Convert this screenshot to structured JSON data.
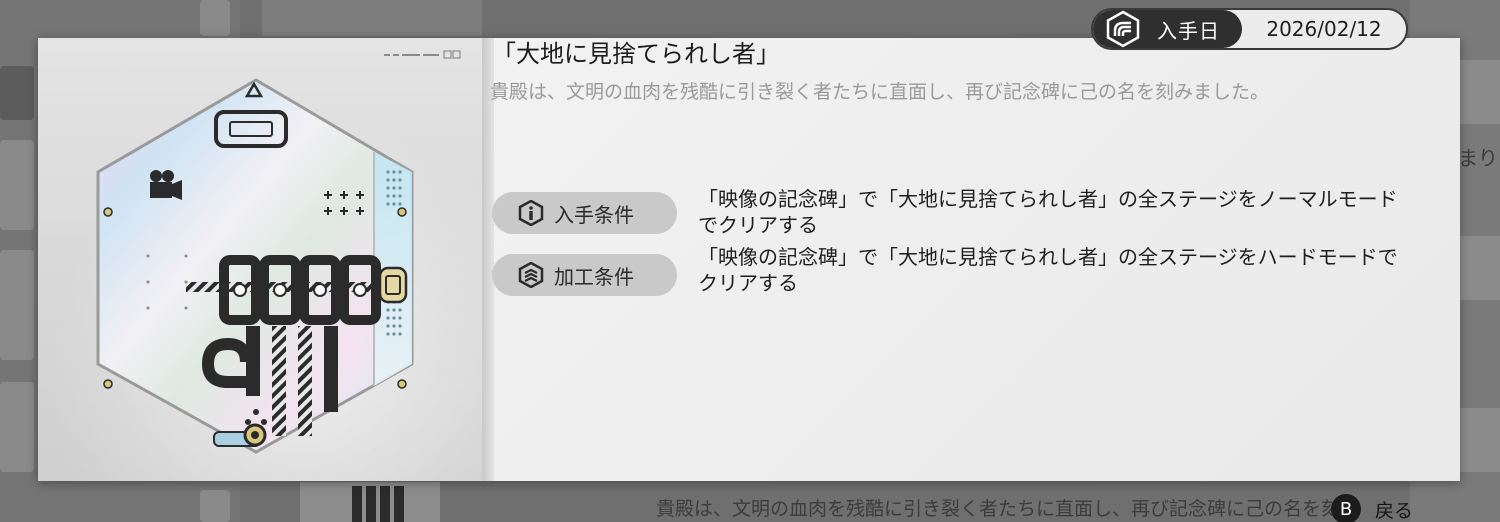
{
  "medal": {
    "title": "「大地に見捨てられし者」",
    "description": "貴殿は、文明の血肉を残酷に引き裂く者たちに直面し、再び記念碑に己の名を刻みました。",
    "acquired": {
      "label": "入手日",
      "date": "2026/02/12",
      "icon": "signal-arc-icon"
    },
    "conditions": [
      {
        "label": "入手条件",
        "icon": "info-hexagon-icon",
        "text": "「映像の記念碑」で「大地に見捨てられし者」の全ステージをノーマルモードでクリアする"
      },
      {
        "label": "加工条件",
        "icon": "layers-hexagon-icon",
        "text": "「映像の記念碑」で「大地に見捨てられし者」の全ステージをハードモードでクリアする"
      }
    ]
  },
  "background": {
    "bottom_text": "貴殿は、文明の血肉を残酷に引き裂く者たちに直面し、再び記念碑に己の名を刻みま",
    "right_glimpse": "まり"
  },
  "footer": {
    "back_button": "B",
    "back_label": "戻る"
  },
  "colors": {
    "accent_dark": "#2f2f2f",
    "pill_bg": "#c9c9c9",
    "description_text": "#9a9a9a"
  }
}
